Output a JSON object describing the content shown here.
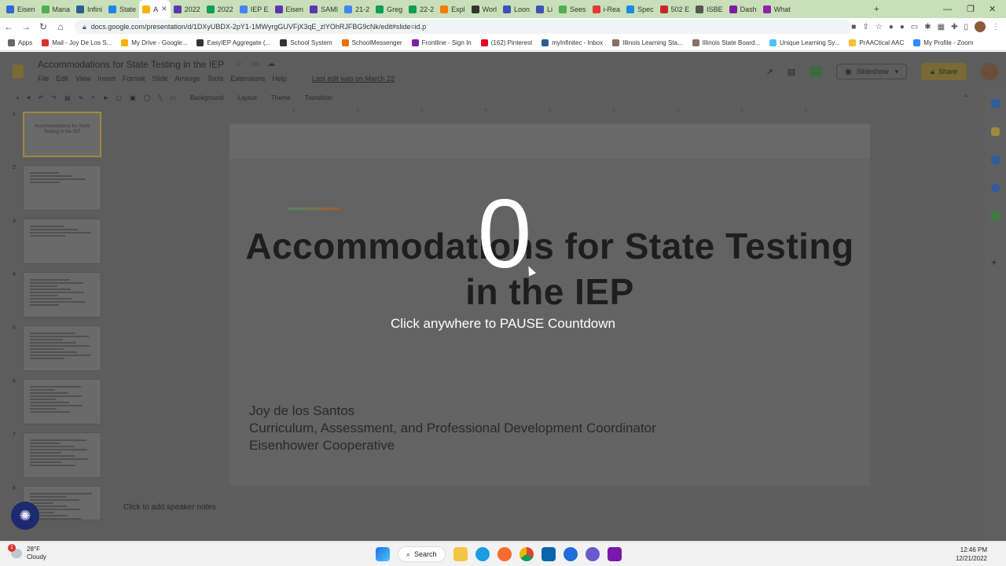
{
  "browser": {
    "tabs": [
      {
        "label": "Eisen",
        "color": "#3367d6"
      },
      {
        "label": "Mana",
        "color": "#4caf50"
      },
      {
        "label": "Infini",
        "color": "#2f5d8a"
      },
      {
        "label": "State",
        "color": "#1e88e5"
      },
      {
        "label": "A",
        "color": "#f4b400",
        "active": true
      },
      {
        "label": "2022",
        "color": "#5e35b1"
      },
      {
        "label": "2022",
        "color": "#0f9d58"
      },
      {
        "label": "IEP E",
        "color": "#4285f4"
      },
      {
        "label": "Eisen",
        "color": "#5e35b1"
      },
      {
        "label": "SAMI",
        "color": "#5e35b1"
      },
      {
        "label": "21-2",
        "color": "#4285f4"
      },
      {
        "label": "Greg",
        "color": "#0f9d58"
      },
      {
        "label": "22-2",
        "color": "#0f9d58"
      },
      {
        "label": "Expl",
        "color": "#f57c00"
      },
      {
        "label": "Worl",
        "color": "#333333"
      },
      {
        "label": "Loon",
        "color": "#3f51b5"
      },
      {
        "label": "Li",
        "color": "#3f51b5"
      },
      {
        "label": "Sees",
        "color": "#4caf50"
      },
      {
        "label": "i-Rea",
        "color": "#e53935"
      },
      {
        "label": "Spec",
        "color": "#1e88e5"
      },
      {
        "label": "502 E",
        "color": "#c62828"
      },
      {
        "label": "ISBE",
        "color": "#555555"
      },
      {
        "label": "Dash",
        "color": "#7b1fa2"
      },
      {
        "label": "What",
        "color": "#8e24aa"
      }
    ],
    "new_tab": "+",
    "window_controls": {
      "minimize": "—",
      "restore": "❐",
      "close": "✕"
    },
    "url": "docs.google.com/presentation/d/1DXyUBDX-2pY1-1MWyrgGUVFjX3qE_zlYOhRJFBG9cNk/edit#slide=id.p",
    "bookmarks": [
      {
        "label": "Apps",
        "color": "#666666"
      },
      {
        "label": "Mail - Joy De Los S...",
        "color": "#d93025"
      },
      {
        "label": "My Drive - Google...",
        "color": "#f4b400"
      },
      {
        "label": "EasyIEP Aggregate (...",
        "color": "#333333"
      },
      {
        "label": "School System",
        "color": "#333333"
      },
      {
        "label": "SchoolMessenger",
        "color": "#e8710a"
      },
      {
        "label": "Frontline - Sign In",
        "color": "#7b1fa2"
      },
      {
        "label": "(162) Pinterest",
        "color": "#e60023"
      },
      {
        "label": "myInfinitec - Inbox",
        "color": "#2f5d8a"
      },
      {
        "label": "Illinois Learning Sta...",
        "color": "#8d6e63"
      },
      {
        "label": "Illinois State Board...",
        "color": "#8d6e63"
      },
      {
        "label": "Unique Learning Sy...",
        "color": "#4fc3f7"
      },
      {
        "label": "PrAACtical AAC",
        "color": "#fbc02d"
      },
      {
        "label": "My Profile - Zoom",
        "color": "#2d8cff"
      }
    ]
  },
  "slides_app": {
    "doc_title": "Accommodations for State Testing in the IEP",
    "menu": [
      "File",
      "Edit",
      "View",
      "Insert",
      "Format",
      "Slide",
      "Arrange",
      "Tools",
      "Extensions",
      "Help"
    ],
    "last_edit": "Last edit was on March 22",
    "slideshow_label": "Slideshow",
    "share_label": "Share",
    "toolbar": {
      "background": "Background",
      "layout": "Layout",
      "theme": "Theme",
      "transition": "Transition"
    },
    "ruler_ticks": [
      "1",
      "2",
      "3",
      "4",
      "5",
      "6",
      "7",
      "8",
      "9"
    ],
    "thumb_numbers": [
      "1",
      "2",
      "3",
      "4",
      "5",
      "6",
      "7",
      "8"
    ],
    "thumb1_title": "Accommodations for State Testing in the IEP",
    "slide_title": "Accommodations for State Testing in the IEP",
    "author_lines": [
      "Joy de los Santos",
      "Curriculum, Assessment, and Professional Development Coordinator",
      "Eisenhower Cooperative"
    ],
    "speaker_notes_placeholder": "Click to add speaker notes"
  },
  "countdown": {
    "number": "0",
    "message": "Click anywhere to PAUSE Countdown"
  },
  "taskbar": {
    "weather_temp": "28°F",
    "weather_desc": "Cloudy",
    "notification_count": "1",
    "search_label": "Search",
    "time": "12:46 PM",
    "date": "12/21/2022"
  }
}
